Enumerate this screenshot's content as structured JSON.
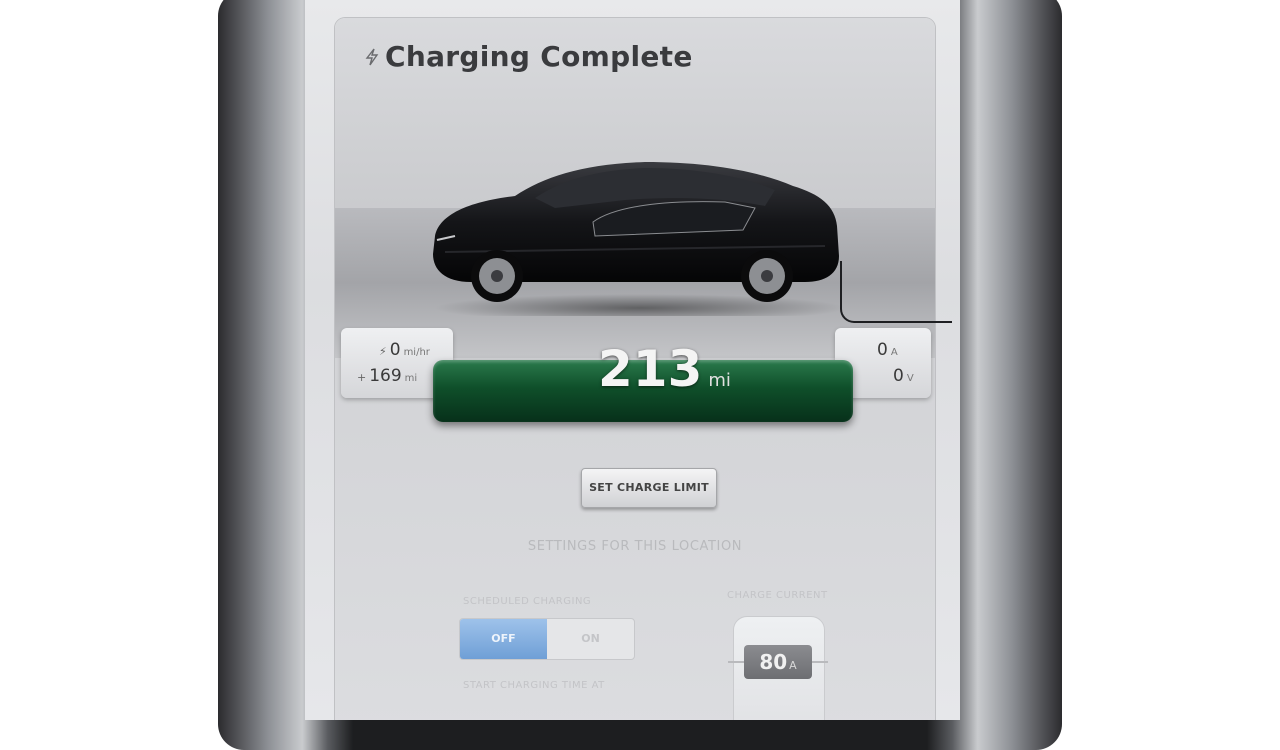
{
  "header": {
    "title": "Charging Complete"
  },
  "stats": {
    "rate_value": "0",
    "rate_unit": "mi/hr",
    "added_value": "169",
    "added_unit": "mi",
    "current_value": "0",
    "current_unit": "A",
    "voltage_value": "0",
    "voltage_unit": "V"
  },
  "battery": {
    "range_value": "213",
    "range_unit": "mi"
  },
  "actions": {
    "set_charge_limit": "SET CHARGE LIMIT"
  },
  "settings": {
    "heading": "SETTINGS FOR THIS LOCATION",
    "scheduled_label": "SCHEDULED CHARGING",
    "toggle_off": "OFF",
    "toggle_on": "ON",
    "scheduled_note": "START CHARGING TIME AT",
    "current_label": "CHARGE CURRENT",
    "current_value": "80",
    "current_unit": "A"
  },
  "colors": {
    "battery_green": "#0f4f2a",
    "toggle_selected": "#6f9fd6"
  },
  "icons": [
    "bolt-icon",
    "rate-icon",
    "added-range-icon",
    "car-image",
    "cable-icon"
  ]
}
